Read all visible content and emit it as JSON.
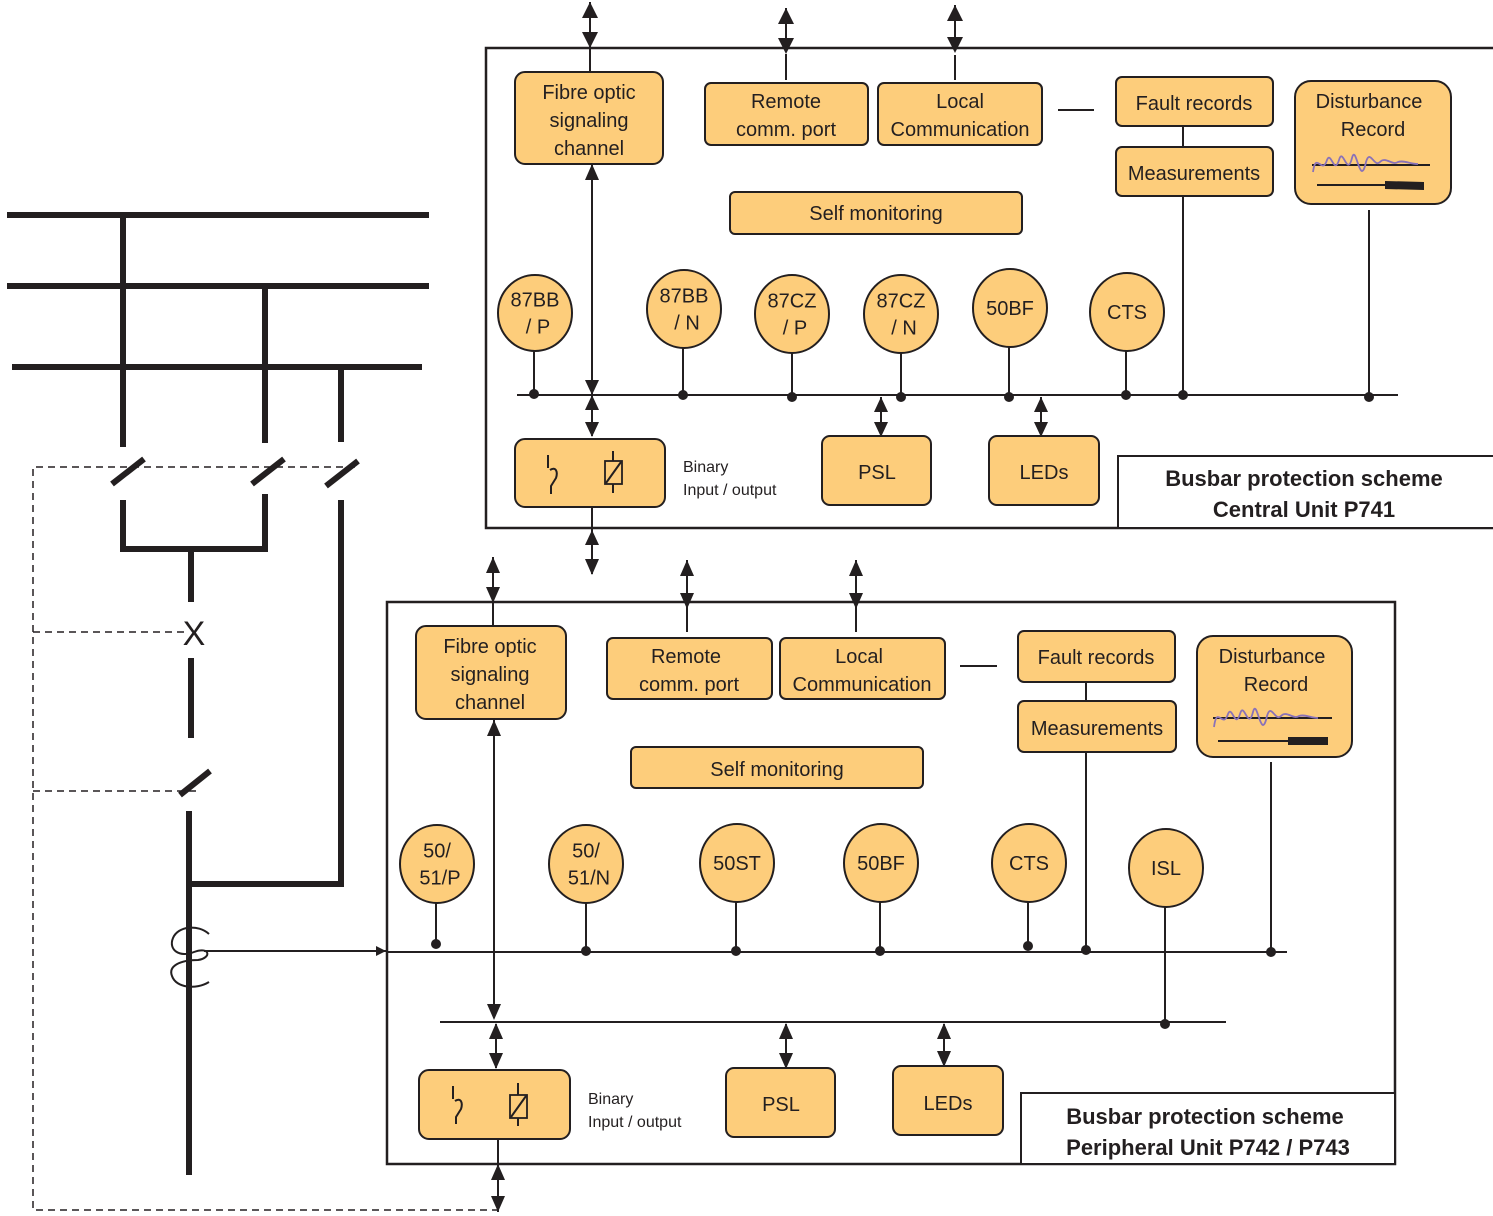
{
  "diagram": {
    "type": "block-diagram",
    "subject": "Busbar protection scheme",
    "colors": {
      "block_fill": "#fdcd7b",
      "line": "#231f20",
      "waveform": "#8a72b8",
      "background": "#ffffff"
    },
    "central_unit": {
      "title_line1": "Busbar protection scheme",
      "title_line2": "Central Unit P741",
      "blocks": {
        "fibre_optic": [
          "Fibre optic",
          "signaling",
          "channel"
        ],
        "remote_comm": [
          "Remote",
          "comm. port"
        ],
        "local_comm": [
          "Local",
          "Communication"
        ],
        "fault_records": "Fault records",
        "measurements": "Measurements",
        "disturbance_record": [
          "Disturbance",
          "Record"
        ],
        "self_monitoring": "Self monitoring",
        "psl": "PSL",
        "leds": "LEDs",
        "binary_io": [
          "Binary",
          "Input / output"
        ]
      },
      "functions": [
        [
          "87BB",
          "/ P"
        ],
        [
          "87BB",
          "/ N"
        ],
        [
          "87CZ",
          "/ P"
        ],
        [
          "87CZ",
          "/ N"
        ],
        [
          "50BF"
        ],
        [
          "CTS"
        ]
      ]
    },
    "peripheral_unit": {
      "title_line1": "Busbar protection scheme",
      "title_line2": "Peripheral Unit P742 / P743",
      "blocks": {
        "fibre_optic": [
          "Fibre optic",
          "signaling",
          "channel"
        ],
        "remote_comm": [
          "Remote",
          "comm. port"
        ],
        "local_comm": [
          "Local",
          "Communication"
        ],
        "fault_records": "Fault records",
        "measurements": "Measurements",
        "disturbance_record": [
          "Disturbance",
          "Record"
        ],
        "self_monitoring": "Self monitoring",
        "psl": "PSL",
        "leds": "LEDs",
        "binary_io": [
          "Binary",
          "Input / output"
        ]
      },
      "functions": [
        [
          "50/",
          "51/P"
        ],
        [
          "50/",
          "51/N"
        ],
        [
          "50ST"
        ],
        [
          "50BF"
        ],
        [
          "CTS"
        ],
        [
          "ISL"
        ]
      ]
    },
    "single_line": {
      "busbars": 3,
      "circuit_breaker_symbol": "X",
      "current_transformer": true
    }
  }
}
